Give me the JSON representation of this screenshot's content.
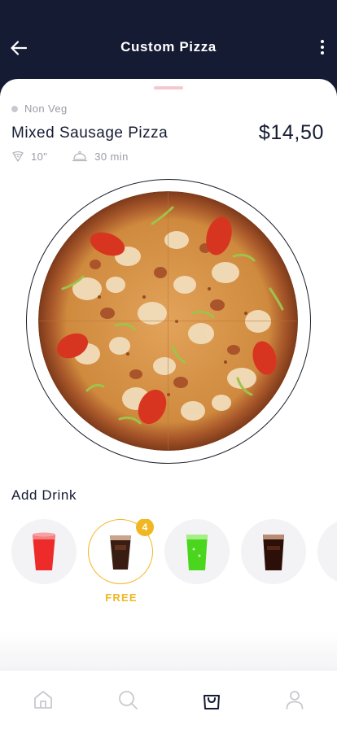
{
  "header": {
    "title": "Custom Pizza",
    "back_icon": "arrow-left-icon",
    "menu_icon": "more-vertical-icon"
  },
  "product": {
    "category": "Non Veg",
    "name": "Mixed Sausage Pizza",
    "price": "$14,50",
    "size": "10\"",
    "time": "30 min"
  },
  "drinks": {
    "title": "Add Drink",
    "items": [
      {
        "name": "red-drink",
        "selected": false
      },
      {
        "name": "cola-drink",
        "selected": true,
        "count": "4",
        "tag": "FREE"
      },
      {
        "name": "green-drink",
        "selected": false
      },
      {
        "name": "cola-drink",
        "selected": false
      },
      {
        "name": "orange-drink",
        "selected": false
      }
    ]
  },
  "nav": {
    "items": [
      "home-icon",
      "search-icon",
      "bag-icon",
      "user-icon"
    ],
    "active": "bag-icon"
  },
  "colors": {
    "primary": "#151b33",
    "accent": "#f0b722",
    "muted": "#9a9ca4"
  }
}
